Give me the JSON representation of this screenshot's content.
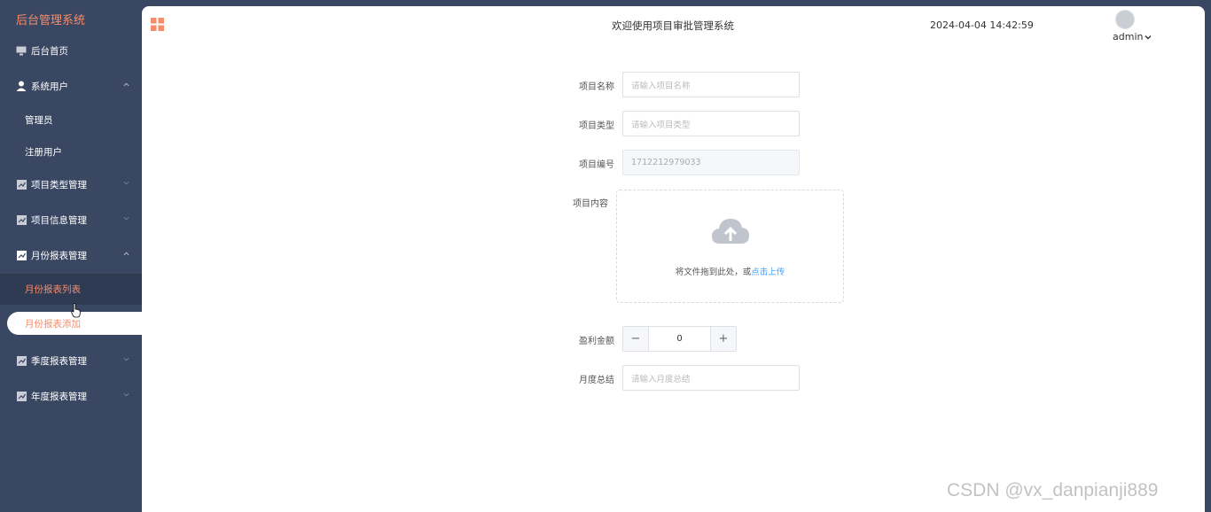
{
  "sidebar": {
    "brand": "后台管理系统",
    "items": [
      {
        "label": "后台首页"
      },
      {
        "label": "系统用户",
        "children": [
          "管理员",
          "注册用户"
        ]
      },
      {
        "label": "项目类型管理"
      },
      {
        "label": "项目信息管理"
      },
      {
        "label": "月份报表管理",
        "children": [
          "月份报表列表",
          "月份报表添加"
        ]
      },
      {
        "label": "季度报表管理"
      },
      {
        "label": "年度报表管理"
      }
    ]
  },
  "header": {
    "welcome": "欢迎使用项目审批管理系统",
    "datetime": "2024-04-04 14:42:59",
    "user": "admin"
  },
  "form": {
    "name": {
      "label": "项目名称",
      "placeholder": "请输入项目名称"
    },
    "type": {
      "label": "项目类型",
      "placeholder": "请输入项目类型"
    },
    "number": {
      "label": "项目编号",
      "value": "1712212979033"
    },
    "content": {
      "label": "项目内容",
      "upload_hint": "将文件拖到此处，或",
      "upload_link": "点击上传"
    },
    "profit": {
      "label": "盈利金额",
      "value": "0",
      "minus": "−",
      "plus": "+"
    },
    "summary": {
      "label": "月度总结",
      "placeholder": "请输入月度总结"
    }
  },
  "watermark": "CSDN @vx_danpianji889",
  "colors": {
    "sidebar_bg": "#3a4762",
    "accent": "#f58c6c",
    "link": "#409eff"
  }
}
